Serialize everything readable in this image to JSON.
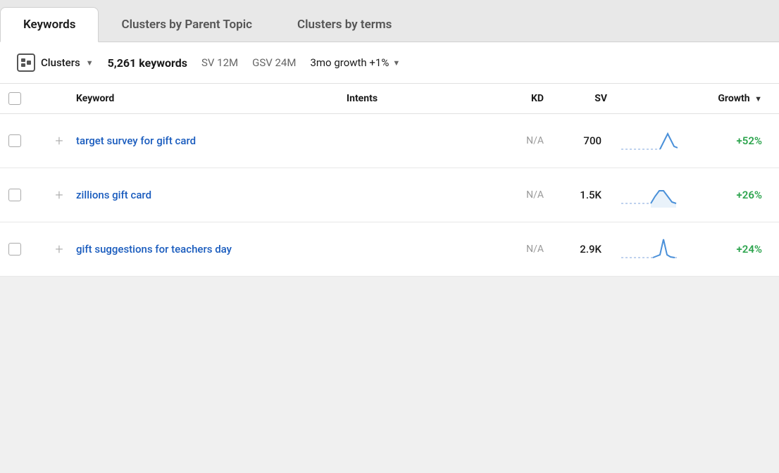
{
  "tabs": [
    {
      "id": "keywords",
      "label": "Keywords",
      "active": true
    },
    {
      "id": "clusters-parent",
      "label": "Clusters by Parent Topic",
      "active": false
    },
    {
      "id": "clusters-terms",
      "label": "Clusters by terms",
      "active": false
    }
  ],
  "toolbar": {
    "clusters_label": "Clusters",
    "keywords_count": "5,261 keywords",
    "sv_label": "SV 12M",
    "gsv_label": "GSV 24M",
    "growth_label": "3mo growth +1%"
  },
  "table": {
    "headers": {
      "keyword": "Keyword",
      "intents": "Intents",
      "kd": "KD",
      "sv": "SV",
      "growth": "Growth"
    },
    "rows": [
      {
        "keyword": "target survey for gift card",
        "intents": "",
        "kd": "N/A",
        "sv": "700",
        "growth": "+52%",
        "sparkline": "up-spike"
      },
      {
        "keyword": "zillions gift card",
        "intents": "",
        "kd": "N/A",
        "sv": "1.5K",
        "growth": "+26%",
        "sparkline": "hump"
      },
      {
        "keyword": "gift suggestions for teachers day",
        "intents": "",
        "kd": "N/A",
        "sv": "2.9K",
        "growth": "+24%",
        "sparkline": "tall-spike"
      }
    ]
  }
}
